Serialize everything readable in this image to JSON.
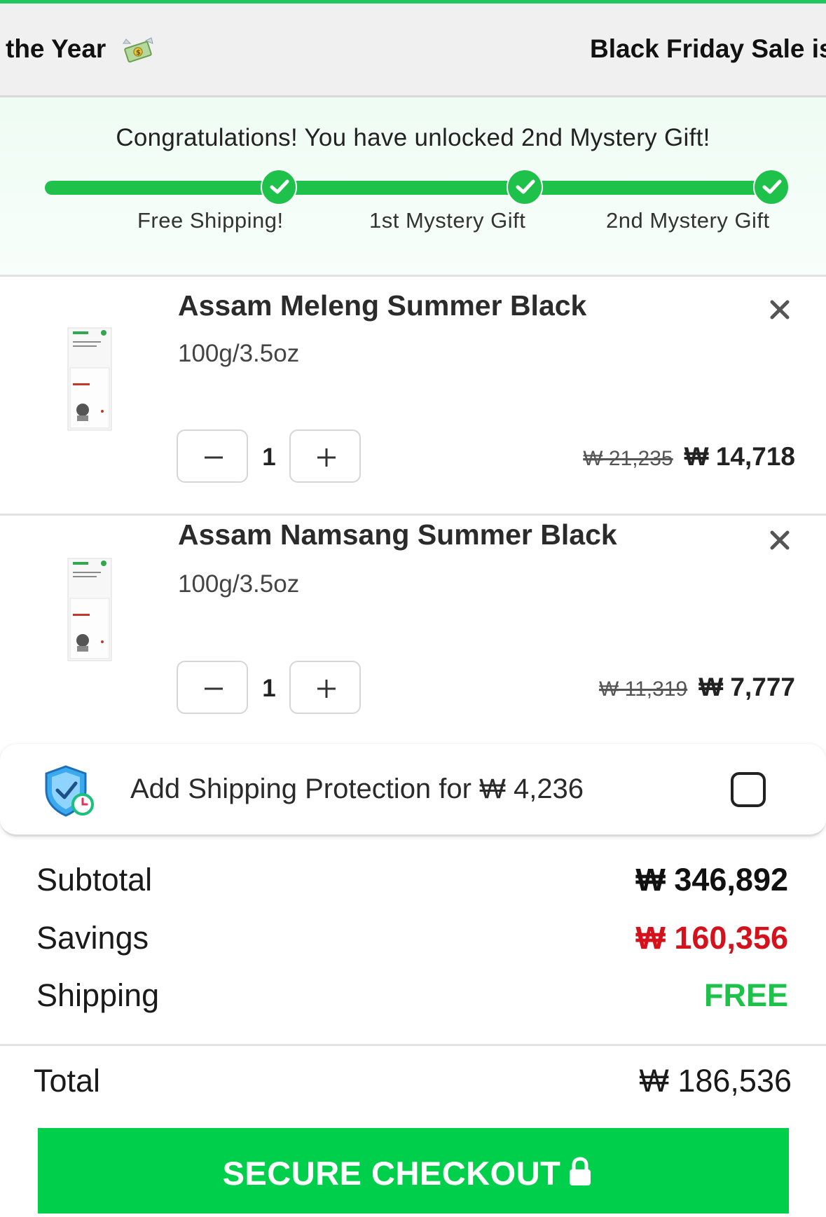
{
  "announcement": {
    "left_text": "the Year",
    "right_text": "Black Friday Sale is"
  },
  "progress": {
    "message": "Congratulations! You have unlocked 2nd Mystery Gift!",
    "milestones": [
      "Free Shipping!",
      "1st Mystery Gift",
      "2nd Mystery Gift"
    ],
    "completed_fraction": 1.0
  },
  "items": [
    {
      "title": "Assam Meleng Summer Black",
      "variant": "100g/3.5oz",
      "quantity": "1",
      "original_price": "₩ 21,235",
      "price": "₩ 14,718"
    },
    {
      "title": "Assam Namsang Summer Black",
      "variant": "100g/3.5oz",
      "quantity": "1",
      "original_price": "₩ 11,319",
      "price": "₩ 7,777"
    }
  ],
  "protection": {
    "label": "Add Shipping Protection for ₩ 4,236",
    "checked": false
  },
  "summary": {
    "subtotal_label": "Subtotal",
    "subtotal_value": "₩ 346,892",
    "savings_label": "Savings",
    "savings_value": "₩ 160,356",
    "shipping_label": "Shipping",
    "shipping_value": "FREE",
    "total_label": "Total",
    "total_value": "₩ 186,536"
  },
  "checkout": {
    "label": "SECURE CHECKOUT"
  },
  "colors": {
    "accent_green": "#00cf4c",
    "savings_red": "#d4121c",
    "free_green": "#1ec24b"
  }
}
